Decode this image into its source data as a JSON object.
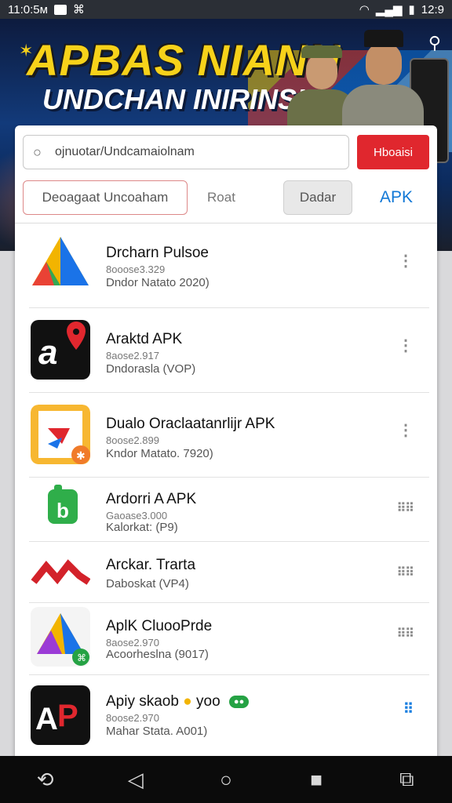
{
  "status_bar": {
    "time_left": "11:0:5м",
    "time_right": "12:9"
  },
  "banner": {
    "title_line1": "APBAS NIANN",
    "title_line2": "UNDCHAN INIRINSIA"
  },
  "search": {
    "query": "ojnuotar/Undcamaiolnam",
    "button_label": "Hboaisi"
  },
  "filters": [
    "Deoagaat Uncoaham",
    "Roat",
    "Dadar",
    "APK"
  ],
  "apps": [
    {
      "name": "Drcharn Pulsoe",
      "sub1": "8ooose3.329",
      "sub2": "Dndor Natato 2020)"
    },
    {
      "name": "Araktd APK",
      "sub1": "8aose2.917",
      "sub2": "Dndorasla (VOP)"
    },
    {
      "name": "Dualo Oraclaatanrlijr APK",
      "sub1": "8oose2.899",
      "sub2": "Kndor Matato. 7920)"
    },
    {
      "name": "Ardorri A APK",
      "sub1": "Gaoase3.000",
      "sub2": "Kalorkat: (P9)"
    },
    {
      "name": "Arckar. Trarta",
      "sub1": "",
      "sub2": "Daboskat (VP4)"
    },
    {
      "name": "AplK CluooPrde",
      "sub1": "8aose2.970",
      "sub2": "Acoorheslna (9017)"
    },
    {
      "name": "Apiy skaob",
      "name_suffix": "yoo",
      "sub1": "8oose2.970",
      "sub2": "Mahar Stata. A001)"
    }
  ],
  "colors": {
    "accent_red": "#e0272e",
    "accent_blue": "#1278d6"
  }
}
